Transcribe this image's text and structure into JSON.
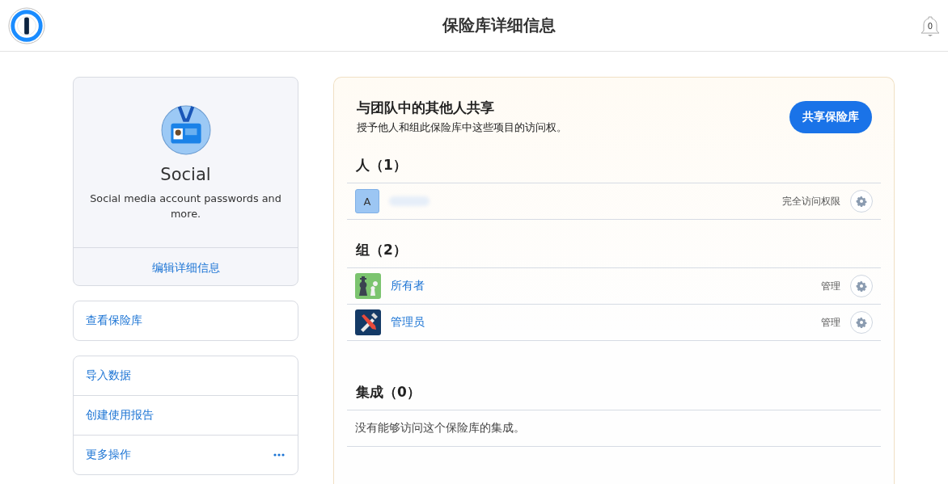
{
  "header": {
    "title": "保险库详细信息",
    "notification_count": "0"
  },
  "vault": {
    "name": "Social",
    "description": "Social media account passwords and more.",
    "edit_link": "编辑详细信息"
  },
  "view_link": "查看保险库",
  "actions": [
    {
      "label": "导入数据",
      "kind": "link"
    },
    {
      "label": "创建使用报告",
      "kind": "link"
    },
    {
      "label": "更多操作",
      "kind": "menu"
    }
  ],
  "share": {
    "title": "与团队中的其他人共享",
    "subtitle": "授予他人和组此保险库中这些项目的访问权。",
    "button": "共享保险库"
  },
  "people": {
    "heading": "人（1）",
    "rows": [
      {
        "kind": "letter",
        "initial": "A",
        "permission": "完全访问权限"
      }
    ]
  },
  "groups": {
    "heading": "组（2）",
    "rows": [
      {
        "kind": "chess",
        "name": "所有者",
        "permission": "管理"
      },
      {
        "kind": "tools",
        "name": "管理员",
        "permission": "管理"
      }
    ]
  },
  "integrations": {
    "heading": "集成（0）",
    "empty_text": "没有能够访问这个保险库的集成。"
  }
}
